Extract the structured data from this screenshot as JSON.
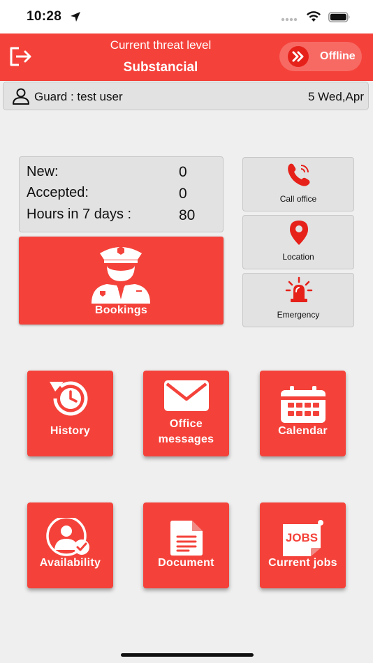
{
  "status_bar": {
    "time": "10:28"
  },
  "header": {
    "threat_label": "Current threat level",
    "threat_value": "Substancial",
    "status": "Offline"
  },
  "guard_bar": {
    "label": "Guard : test user",
    "date": "5 Wed,Apr"
  },
  "stats": [
    {
      "label": "New:",
      "value": "0"
    },
    {
      "label": "Accepted:",
      "value": "0"
    },
    {
      "label": "Hours in 7 days :",
      "value": "80"
    }
  ],
  "bookings": {
    "label": "Bookings"
  },
  "side_buttons": {
    "call": "Call office",
    "location": "Location",
    "emergency": "Emergency"
  },
  "tiles": {
    "history": "History",
    "office_line1": "Office",
    "office_line2": "messages",
    "calendar": "Calendar",
    "availability": "Availability",
    "document": "Document",
    "current_jobs": "Current jobs",
    "jobs_icon_text": "JOBS"
  },
  "colors": {
    "accent": "#f4423a",
    "panel": "#e2e2e2",
    "background": "#efefef"
  }
}
